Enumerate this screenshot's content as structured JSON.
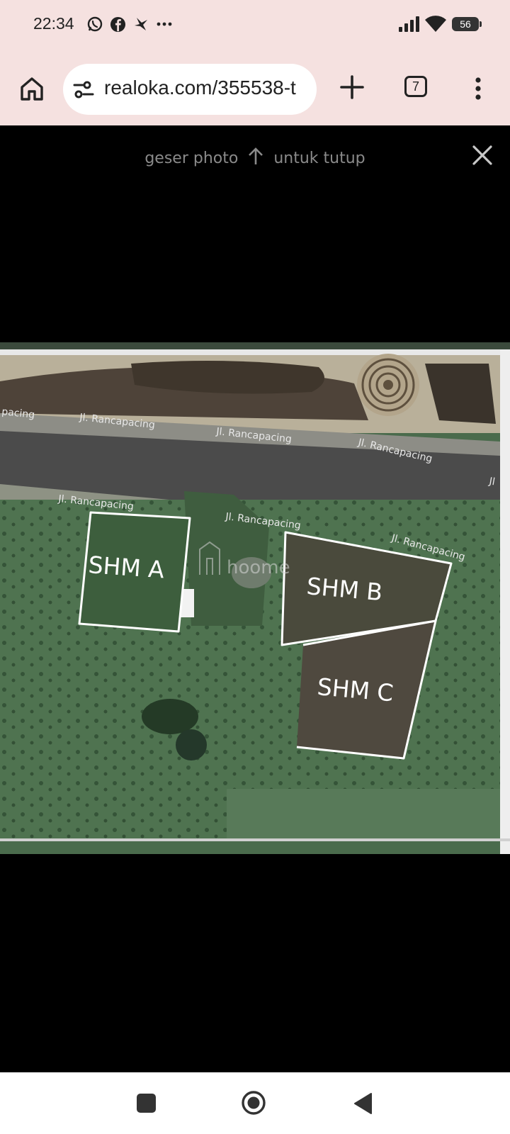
{
  "status": {
    "time": "22:34",
    "battery": "56",
    "left_icons": [
      "whatsapp-icon",
      "facebook-icon",
      "bird-app-icon",
      "more-notifications-icon"
    ],
    "right_icons": [
      "signal-icon",
      "wifi-icon",
      "battery-icon"
    ]
  },
  "browser": {
    "url": "realoka.com/355538-t",
    "tab_count": "7"
  },
  "viewer": {
    "hint_before": "geser photo",
    "hint_after": "untuk tutup",
    "hint_icon": "arrow-up-icon"
  },
  "photo": {
    "road_labels": [
      "pacing",
      "Jl. Rancapacing",
      "Jl. Rancapacing",
      "Jl. Rancapacing",
      "Jl",
      "Jl. Rancapacing",
      "Jl. Rancapacing",
      "Jl. Rancapacing"
    ],
    "plots": [
      "SHM A",
      "SHM B",
      "SHM C"
    ],
    "watermark": "hoome"
  },
  "colors": {
    "chrome_bg": "#f5e1e0",
    "viewer_bg": "#000000",
    "plot_outline": "#ffffff"
  }
}
